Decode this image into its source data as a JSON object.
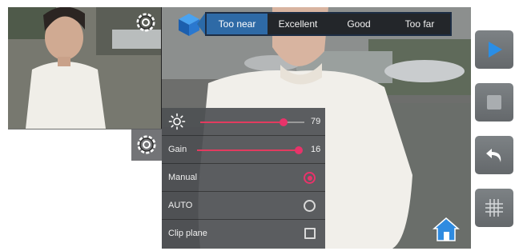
{
  "distance_indicator": {
    "segments": [
      "Too near",
      "Excellent",
      "Good",
      "Too far"
    ],
    "active_index": 0
  },
  "settings": {
    "exposure": {
      "icon": "brightness-icon",
      "value": "79",
      "level": 0.8
    },
    "gain": {
      "label": "Gain",
      "value": "16",
      "level": 0.98
    },
    "manual": {
      "label": "Manual",
      "selected": true
    },
    "auto": {
      "label": "AUTO",
      "selected": false
    },
    "clip_plane": {
      "label": "Clip plane",
      "checked": false
    }
  },
  "toolbar": {
    "icons": [
      "play-icon",
      "stop-icon",
      "undo-icon",
      "grid-icon"
    ]
  },
  "colors": {
    "accent": "#e8336a",
    "indicator_active": "#2e6aa6",
    "play_blue": "#2a8ee6"
  }
}
